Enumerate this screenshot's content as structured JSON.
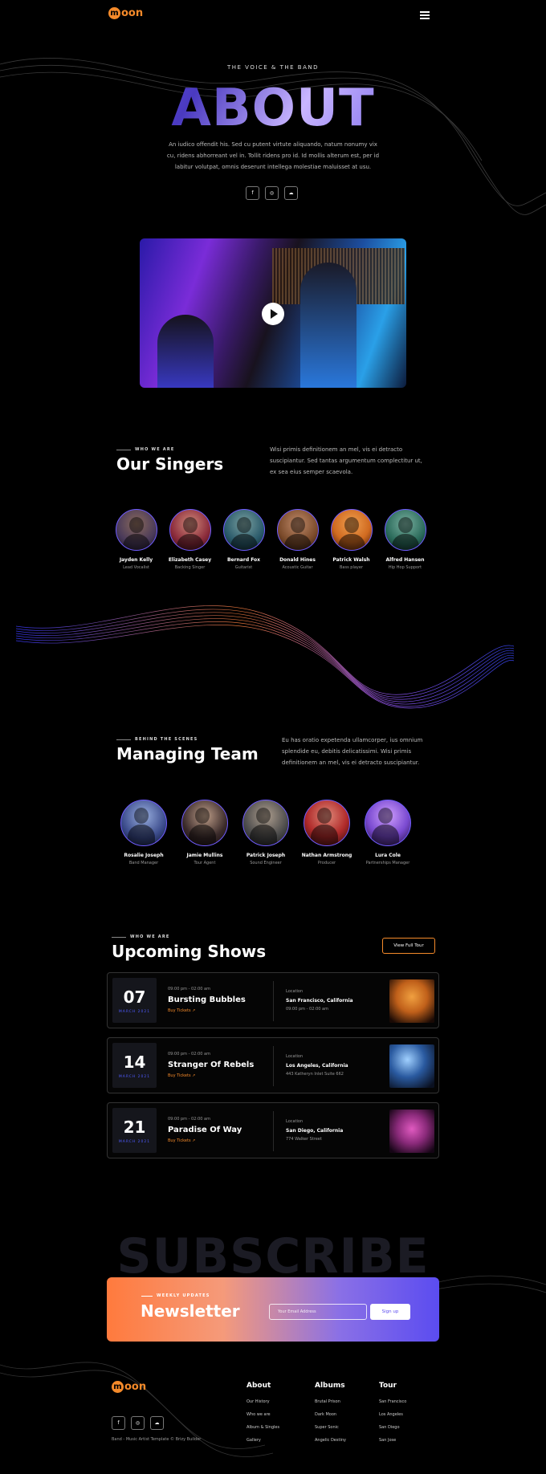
{
  "header": {
    "logo_mark": "m",
    "logo_text": "oon"
  },
  "hero": {
    "eyebrow": "THE VOICE & THE BAND",
    "title": "ABOUT",
    "text": "An iudico offendit his. Sed cu putent virtute aliquando, natum nonumy vix cu, ridens abhorreant vel in. Tollit ridens pro id. Id mollis alterum est, per id labitur volutpat, omnis deserunt intellega molestiae maluisset at usu.",
    "social": [
      {
        "icon": "facebook-icon",
        "glyph": "f"
      },
      {
        "icon": "instagram-icon",
        "glyph": "◎"
      },
      {
        "icon": "soundcloud-icon",
        "glyph": "☁"
      }
    ]
  },
  "singers": {
    "eyebrow": "WHO WE ARE",
    "title": "Our Singers",
    "text": "Wisi primis definitionem an mel, vis ei detracto suscipiantur. Sed tantas argumentum complectitur ut, ex sea eius semper scaevola.",
    "members": [
      {
        "name": "Jayden Kelly",
        "role": "Lead Vocalist",
        "color": "#4a3a5a"
      },
      {
        "name": "Elizabeth Casey",
        "role": "Backing Singer",
        "color": "#8a2a3a"
      },
      {
        "name": "Bernard Fox",
        "role": "Guitarist",
        "color": "#2a5a6a"
      },
      {
        "name": "Donald Hines",
        "role": "Acoustic Guitar",
        "color": "#7a4a2a"
      },
      {
        "name": "Patrick Walsh",
        "role": "Bass player",
        "color": "#d06a20"
      },
      {
        "name": "Alfred Hansen",
        "role": "Hip Hop Support",
        "color": "#2a6a5a"
      }
    ]
  },
  "team": {
    "eyebrow": "BEHIND THE SCENES",
    "title": "Managing Team",
    "text": "Eu has oratio expetenda ullamcorper, ius omnium splendide eu, debitis delicatissimi. Wisi primis definitionem an mel, vis ei detracto suscipiantur.",
    "members": [
      {
        "name": "Rosalie Joseph",
        "role": "Band Manager",
        "color": "#3a4a8a"
      },
      {
        "name": "Jamie Mullins",
        "role": "Tour Agent",
        "color": "#3a2a2a"
      },
      {
        "name": "Patrick Joseph",
        "role": "Sound Engineer",
        "color": "#4a4a4a"
      },
      {
        "name": "Nathan Armstrong",
        "role": "Producer",
        "color": "#b02a2a"
      },
      {
        "name": "Lura Cole",
        "role": "Partnerships Manager",
        "color": "#7a4ad0"
      }
    ]
  },
  "shows": {
    "eyebrow": "WHO WE ARE",
    "title": "Upcoming Shows",
    "view_all": "View Full Tour",
    "items": [
      {
        "day": "07",
        "month": "MARCH 2021",
        "time": "09:00 pm - 02:00 am",
        "title": "Bursting Bubbles",
        "buy": "Buy Tickets ↗",
        "location_label": "Location",
        "city": "San Francisco, California",
        "address": "09:00 pm - 02:00 am",
        "thumb": "#c0601a"
      },
      {
        "day": "14",
        "month": "MARCH 2021",
        "time": "09:00 pm - 02:00 am",
        "title": "Stranger Of Rebels",
        "buy": "Buy Tickets ↗",
        "location_label": "Location",
        "city": "Los Angeles, California",
        "address": "443 Katheryn Inlet Suite 662",
        "thumb": "#2a5aa0"
      },
      {
        "day": "21",
        "month": "MARCH 2021",
        "time": "09:00 pm - 02:00 am",
        "title": "Paradise Of Way",
        "buy": "Buy Tickets ↗",
        "location_label": "Location",
        "city": "San Diego, California",
        "address": "774 Walker Street",
        "thumb": "#8a2a7a"
      }
    ]
  },
  "subscribe": {
    "bg_word": "SUBSCRIBE",
    "eyebrow": "WEEKLY UPDATES",
    "title": "Newsletter",
    "placeholder": "Your Email Address",
    "button": "Sign up"
  },
  "footer": {
    "copyright": "Band - Music Artist Template © Brizy Builder",
    "columns": [
      {
        "title": "About",
        "links": [
          "Our History",
          "Who we are",
          "Album & Singles",
          "Gallery"
        ]
      },
      {
        "title": "Albums",
        "links": [
          "Brutal Prison",
          "Dark Moon",
          "Super Sonic",
          "Angelic Destiny"
        ]
      },
      {
        "title": "Tour",
        "links": [
          "San Francisco",
          "Los Angeles",
          "San Diego",
          "San Jose"
        ]
      }
    ]
  }
}
